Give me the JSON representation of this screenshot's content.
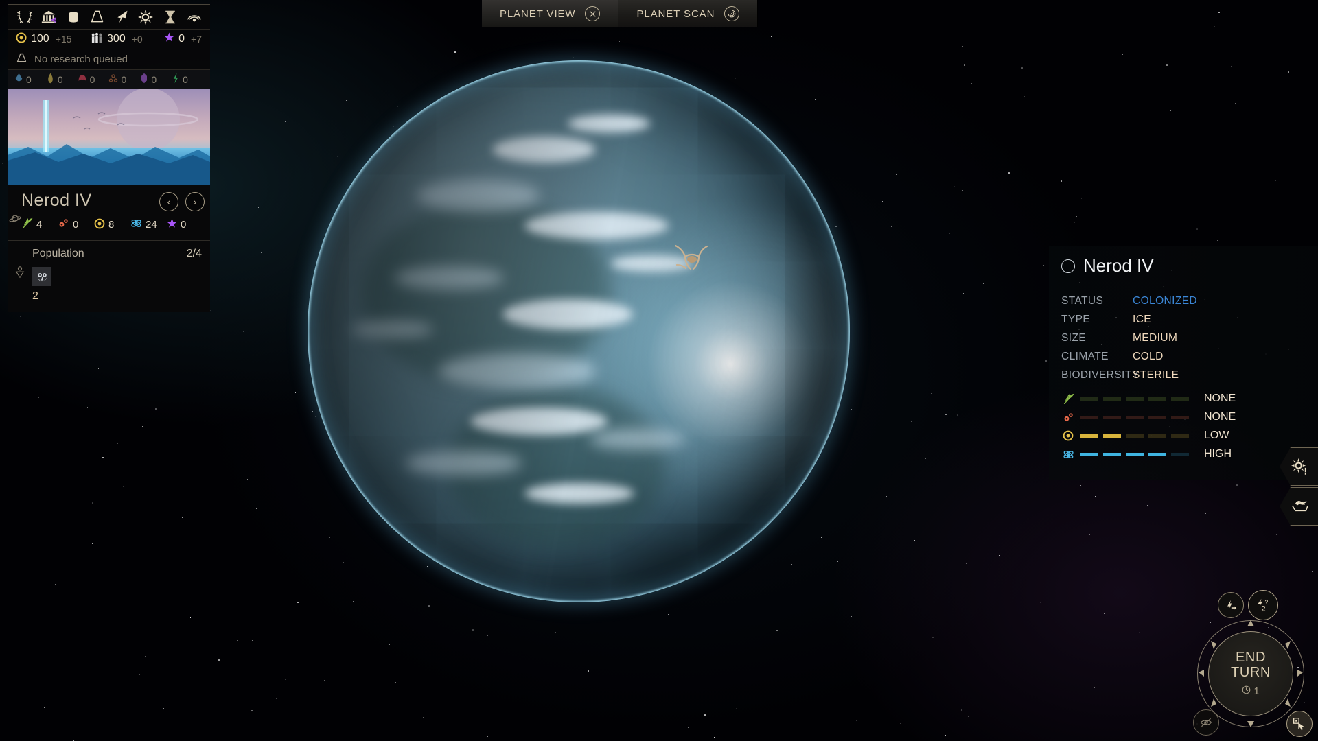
{
  "tabs": [
    {
      "label": "PLANET VIEW",
      "icon": "close-icon",
      "active": true
    },
    {
      "label": "PLANET SCAN",
      "icon": "scan-icon",
      "active": false
    }
  ],
  "hud": {
    "toolbar_icons": [
      "laurel-wreath-icon",
      "government-icon",
      "coins-icon",
      "research-flask-icon",
      "expansion-arrow-icon",
      "influence-star-icon",
      "hourglass-icon",
      "diplomacy-icon"
    ],
    "resources": [
      {
        "name": "dust",
        "icon": "dust-coin-icon",
        "value": "100",
        "delta": "+15",
        "color": "#e8c34a"
      },
      {
        "name": "population",
        "icon": "population-icon",
        "value": "300",
        "delta": "+0",
        "color": "#dcdcdc"
      },
      {
        "name": "influence",
        "icon": "influence-star-icon",
        "value": "0",
        "delta": "+7",
        "color": "#a855f7"
      }
    ],
    "research_status": "No research queued",
    "strategic_resources": [
      {
        "name": "titanium",
        "value": "0",
        "color": "#3f6e8f"
      },
      {
        "name": "hyperium",
        "value": "0",
        "color": "#8a7a3a"
      },
      {
        "name": "adamantian",
        "value": "0",
        "color": "#8e2f3f"
      },
      {
        "name": "orichalcix",
        "value": "0",
        "color": "#7a4a30"
      },
      {
        "name": "mithrite",
        "value": "0",
        "color": "#6a3f8a"
      },
      {
        "name": "quadrinix",
        "value": "0",
        "color": "#2f9a55"
      }
    ]
  },
  "planet_card": {
    "name": "Nerod IV",
    "prev_label": "‹",
    "next_label": "›",
    "stats": [
      {
        "name": "food",
        "icon": "food-wheat-icon",
        "value": "4",
        "color": "#8fbf4a"
      },
      {
        "name": "industry",
        "icon": "industry-gears-icon",
        "value": "0",
        "color": "#e8694a"
      },
      {
        "name": "dust",
        "icon": "dust-coin-icon",
        "value": "8",
        "color": "#e8c34a"
      },
      {
        "name": "science",
        "icon": "science-atom-icon",
        "value": "24",
        "color": "#4ab8e8"
      },
      {
        "name": "influence",
        "icon": "influence-star-icon",
        "value": "0",
        "color": "#a855f7"
      }
    ],
    "population_label": "Population",
    "population_value": "2/4",
    "population_slot_count": "2",
    "slot_icon": "pop-unit-icon"
  },
  "info_panel": {
    "title": "Nerod IV",
    "title_icon": "planet-circle-icon",
    "rows": [
      {
        "key": "STATUS",
        "value": "COLONIZED",
        "value_color": "#3b86d6"
      },
      {
        "key": "TYPE",
        "value": "ICE",
        "value_color": "#f0d9bd"
      },
      {
        "key": "SIZE",
        "value": "MEDIUM",
        "value_color": "#f0d9bd"
      },
      {
        "key": "CLIMATE",
        "value": "COLD",
        "value_color": "#f0d9bd"
      },
      {
        "key": "BIODIVERSITY",
        "value": "STERILE",
        "value_color": "#f0d9bd"
      }
    ],
    "bars": [
      {
        "name": "food",
        "icon": "food-wheat-icon",
        "icon_color": "#8fbf4a",
        "filled": 0,
        "total": 5,
        "fill_color": "#8fbf4a",
        "label": "NONE"
      },
      {
        "name": "industry",
        "icon": "industry-gears-icon",
        "icon_color": "#e8694a",
        "filled": 0,
        "total": 5,
        "fill_color": "#e8694a",
        "label": "NONE"
      },
      {
        "name": "dust",
        "icon": "dust-coin-icon",
        "icon_color": "#e8c34a",
        "filled": 2,
        "total": 5,
        "fill_color": "#d8b43c",
        "label": "LOW"
      },
      {
        "name": "science",
        "icon": "science-atom-icon",
        "icon_color": "#4ab8e8",
        "filled": 4,
        "total": 5,
        "fill_color": "#3fb4e0",
        "label": "HIGH"
      }
    ]
  },
  "side_buttons": [
    {
      "name": "empire-alert-button",
      "icon": "sun-alert-icon"
    },
    {
      "name": "trade-route-button",
      "icon": "cargo-hand-icon"
    }
  ],
  "end_turn": {
    "line1": "END",
    "line2": "TURN",
    "turn_icon": "clock-icon",
    "turn_value": "1",
    "top_buttons": [
      {
        "name": "next-movement-button",
        "icon": "ship-move-icon",
        "badge": ""
      },
      {
        "name": "idle-ships-button",
        "icon": "ship-question-icon",
        "badge": "2"
      }
    ],
    "corner_buttons": [
      {
        "name": "visibility-toggle-button",
        "icon": "eye-off-icon"
      },
      {
        "name": "selection-mode-button",
        "icon": "hand-select-icon"
      }
    ]
  }
}
